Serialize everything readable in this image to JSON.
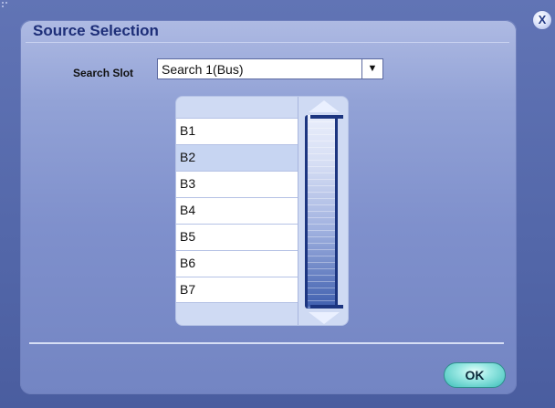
{
  "dialog": {
    "title": "Source Selection",
    "close_label": "X",
    "search_slot": {
      "label": "Search Slot",
      "value": "Search 1(Bus)",
      "arrow": "▼"
    },
    "list": {
      "items": [
        "B1",
        "B2",
        "B3",
        "B4",
        "B5",
        "B6",
        "B7"
      ],
      "selected": "B2"
    },
    "ok_label": "OK"
  },
  "colors": {
    "accent": "#1d2e78",
    "background": "#5a6fae",
    "selection": "#c7d5f2",
    "ok_button": "#3bbfb9"
  },
  "icons": {
    "close": "close-icon",
    "dropdown": "chevron-down-icon",
    "scroll_up": "scroll-up-arrow-icon",
    "scroll_down": "scroll-down-arrow-icon",
    "resize": "resize-grip-icon"
  }
}
